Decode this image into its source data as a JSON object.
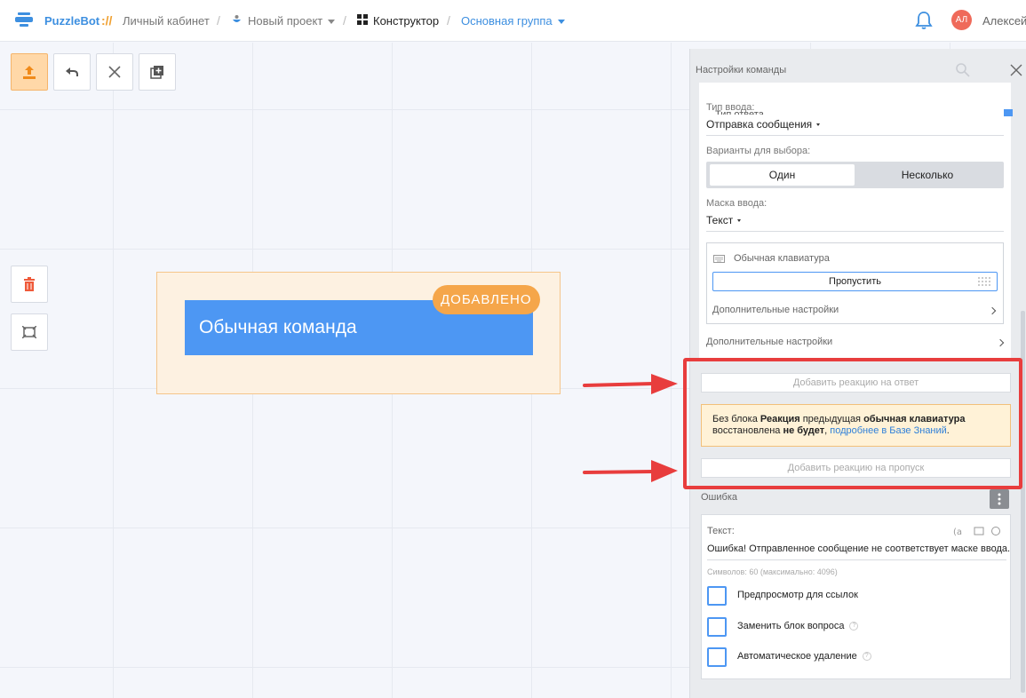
{
  "header": {
    "brand": "PuzzleBot",
    "brand_sep": "://",
    "crumbs": [
      "Личный кабинет",
      "Новый проект",
      "Конструктор",
      "Основная группа"
    ],
    "user": "Алексей",
    "avatar_initials": "АЛ"
  },
  "canvas": {
    "node_title": "Обычная команда",
    "node_badge": "ДОБАВЛЕНО"
  },
  "panel": {
    "title": "Настройки команды",
    "cut_value": "Тип ответа",
    "input_type_label": "Тип ввода:",
    "input_type_value": "Отправка сообщения",
    "choice_label": "Варианты для выбора:",
    "choice_one": "Один",
    "choice_many": "Несколько",
    "mask_label": "Маска ввода:",
    "mask_value": "Текст",
    "keyboard_title": "Обычная клавиатура",
    "skip_label": "Пропустить",
    "keyboard_more": "Дополнительные настройки",
    "more_settings": "Дополнительные настройки",
    "add_reaction_answer": "Добавить реакцию на ответ",
    "warn_part1": "Без блока ",
    "warn_bold1": "Реакция",
    "warn_part2": " предыдущая ",
    "warn_bold2": "обычная клавиатура",
    "warn_part3": " восстановлена ",
    "warn_bold3": "не будет",
    "warn_part4": ", ",
    "warn_link": "подробнее в Базе Знаний",
    "warn_part5": ".",
    "add_reaction_skip": "Добавить реакцию на пропуск",
    "error_title": "Ошибка",
    "error_text_label": "Текст:",
    "error_text": "Ошибка! Отправленное сообщение не соответствует маске ввода.",
    "error_count": "Символов: 60 (максимально: 4096)",
    "cb_preview": "Предпросмотр для ссылок",
    "cb_replace": "Заменить блок вопроса",
    "cb_autodelete": "Автоматическое удаление"
  },
  "colors": {
    "accent": "#4d97f3",
    "brand": "#3d8fe0",
    "warn_bg": "#fff2d7",
    "highlight": "#e83d3d",
    "badge": "#f5a64a"
  }
}
